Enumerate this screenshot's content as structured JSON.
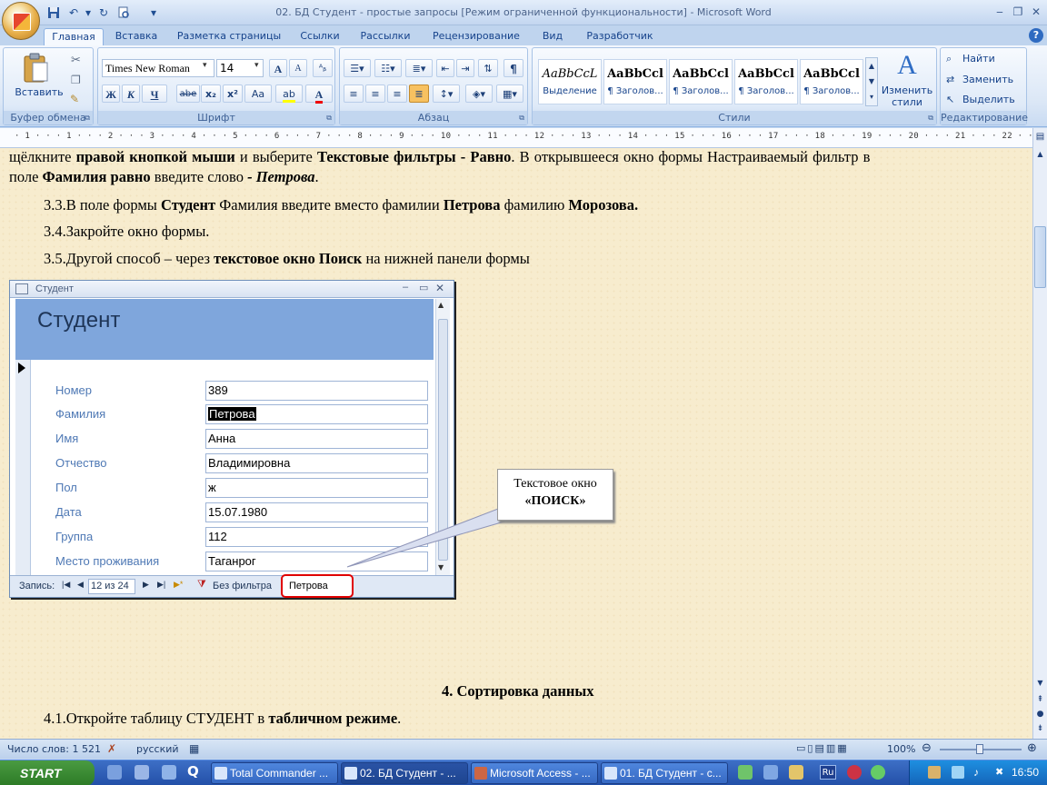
{
  "window": {
    "title": "02. БД Студент - простые запросы [Режим ограниченной функциональности] - Microsoft Word",
    "min_icon": "minimize-icon",
    "max_icon": "maximize-icon",
    "close_icon": "close-icon"
  },
  "quick_access": [
    "save-icon",
    "undo-icon",
    "redo-icon",
    "print-preview-icon",
    "customize-icon"
  ],
  "tabs": [
    "Главная",
    "Вставка",
    "Разметка страницы",
    "Ссылки",
    "Рассылки",
    "Рецензирование",
    "Вид",
    "Разработчик"
  ],
  "active_tab": "Главная",
  "ribbon": {
    "clipboard": {
      "label": "Буфер обмена",
      "paste": "Вставить"
    },
    "font": {
      "label": "Шрифт",
      "name": "Times New Roman",
      "size": "14",
      "bold": "Ж",
      "italic": "К",
      "underline": "Ч",
      "strike": "abe",
      "sub": "x₂",
      "sup": "x²",
      "case": "Aa",
      "grow": "A",
      "shrink": "A"
    },
    "paragraph": {
      "label": "Абзац",
      "pilcrow": "¶"
    },
    "styles": {
      "label": "Стили",
      "items": [
        {
          "sample": "AaBbCcL",
          "name": "Выделение"
        },
        {
          "sample": "AaBbCcl",
          "name": "¶ Заголов..."
        },
        {
          "sample": "AaBbCcl",
          "name": "¶ Заголов..."
        },
        {
          "sample": "AaBbCcl",
          "name": "¶ Заголов..."
        },
        {
          "sample": "AaBbCcl",
          "name": "¶ Заголов..."
        }
      ],
      "change": "Изменить стили"
    },
    "editing": {
      "label": "Редактирование",
      "find": "Найти",
      "replace": "Заменить",
      "select": "Выделить"
    }
  },
  "ruler": "· 1 · · · 1 · · · 2 · · · 3 · · · 4 · · · 5 · · · 6 · · · 7 · · · 8 · · · 9 · · · 10 · · · 11 · · · 12 · · · 13 · · · 14 · · · 15 · · · 16 · · · 17 · · · 18 · · · 19 · · · 20 · · · 21 · · · 22 · · · 23 · · · 24 · · · 25 · · · 26 · · · 27 · · · 28 · · · 29 ·",
  "doc": {
    "line1": {
      "a": "щёлкните ",
      "b": "правой кнопкой мыши",
      "c": " и выберите ",
      "d": "Текстовые фильтры - Равно",
      "e": ". В открывшееся окно формы Настраиваемый фильтр в"
    },
    "line2": {
      "a": "поле ",
      "b": "Фамилия равно",
      "c": " введите слово ",
      "d": "- Петрова",
      "e": "."
    },
    "p33": {
      "a": "3.3.В поле формы ",
      "b": "Студент",
      "c": " Фамилия введите вместо фамилии ",
      "d": "Петрова",
      "e": " фамилию ",
      "f": "Морозова."
    },
    "p34": "3.4.Закройте окно формы.",
    "p35": {
      "a": "3.5.Другой способ – через ",
      "b": "текстовое окно Поиск",
      "c": " на нижней панели формы"
    },
    "heading4": "4.  Сортировка данных",
    "p41": {
      "a": "4.1.Откройте таблицу СТУДЕНТ в ",
      "b": "табличном режиме",
      "c": "."
    }
  },
  "form": {
    "window_title": "Студент",
    "header": "Студент",
    "fields": [
      {
        "label": "Номер",
        "value": "389"
      },
      {
        "label": "Фамилия",
        "value": "Петрова"
      },
      {
        "label": "Имя",
        "value": "Анна"
      },
      {
        "label": "Отчество",
        "value": "Владимировна"
      },
      {
        "label": "Пол",
        "value": "ж"
      },
      {
        "label": "Дата",
        "value": "15.07.1980"
      },
      {
        "label": "Группа",
        "value": "112"
      },
      {
        "label": "Место проживания",
        "value": "Таганрог"
      }
    ],
    "nav": {
      "label": "Запись:",
      "record": "12 из 24",
      "filter": "Без фильтра",
      "search": "Петрова"
    }
  },
  "callout": {
    "line1": "Текстовое окно",
    "line2": "«ПОИСК»"
  },
  "status": {
    "words": "Число слов: 1 521",
    "lang": "русский",
    "zoom": "100%"
  },
  "taskbar": {
    "start": "START",
    "tasks": [
      "Total Commander ...",
      "02. БД Студент - ...",
      "Microsoft Access - ...",
      "01. БД Студент - с..."
    ],
    "lang": "Ru",
    "time": "16:50"
  },
  "colors": {
    "accent": "#15428b",
    "page": "#f7ecce",
    "highlight": "#d40000"
  }
}
